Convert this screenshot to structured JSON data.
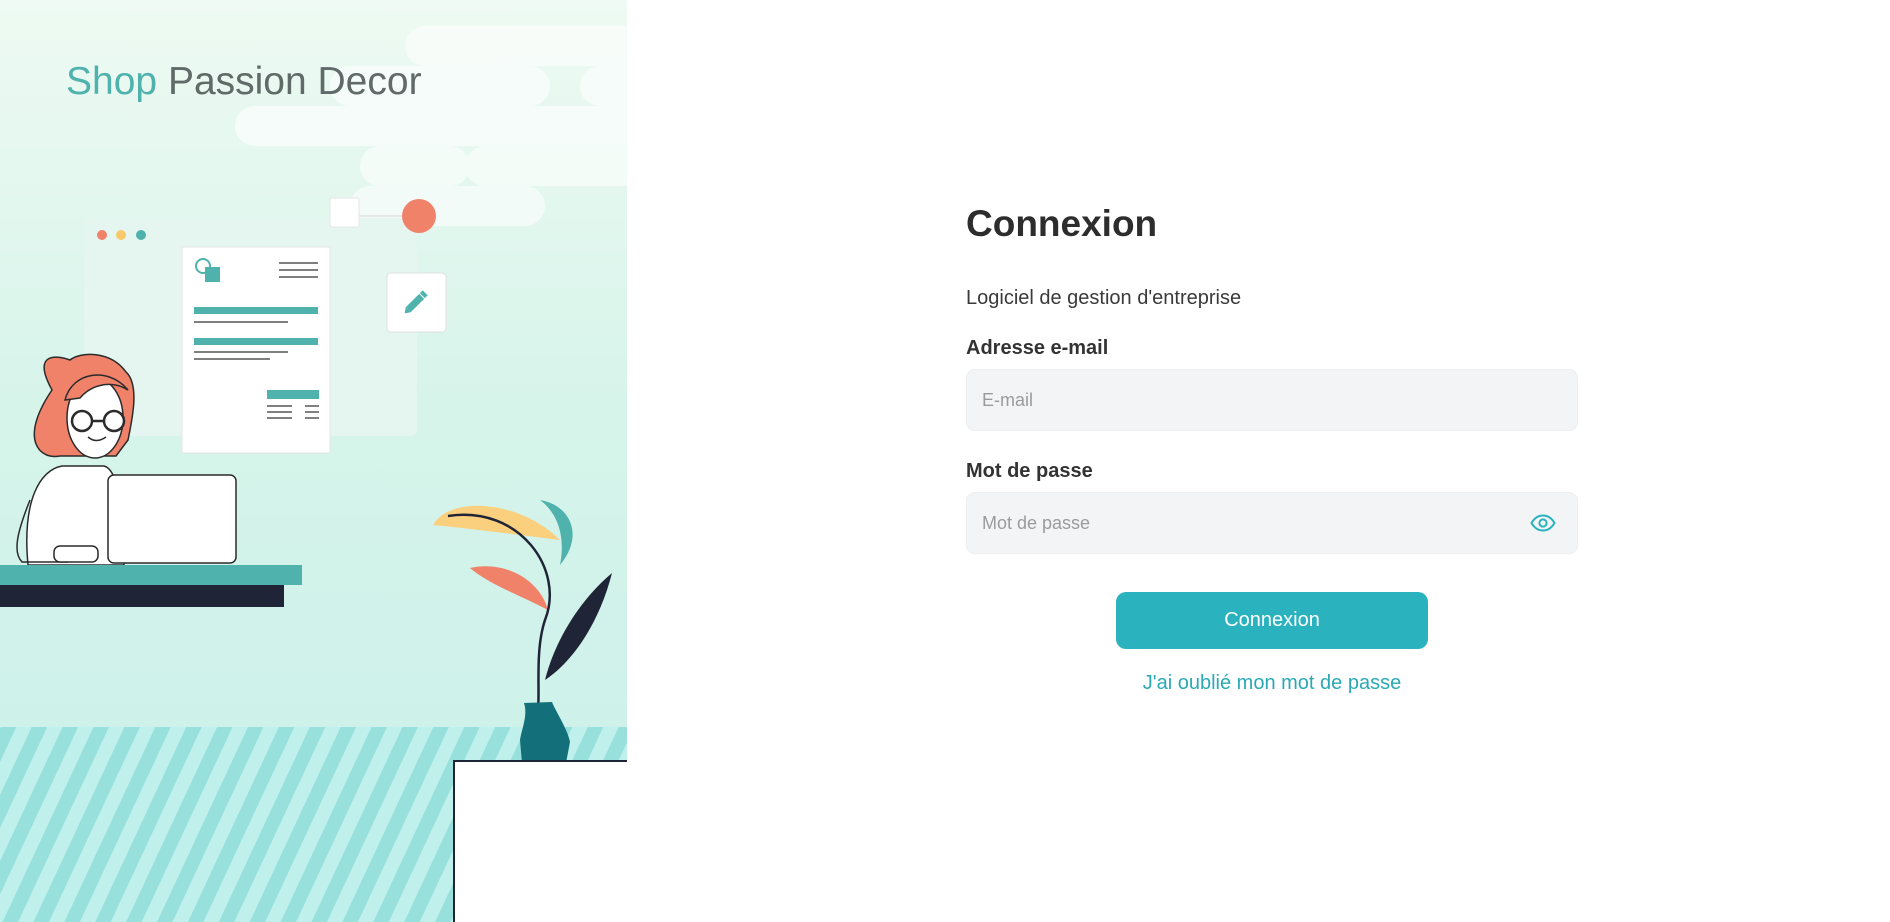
{
  "brand": {
    "part1": "Shop",
    "part2": "Passion Decor"
  },
  "login": {
    "title": "Connexion",
    "subtitle": "Logiciel de gestion d'entreprise",
    "email_label": "Adresse e-mail",
    "email_placeholder": "E-mail",
    "email_value": "",
    "password_label": "Mot de passe",
    "password_placeholder": "Mot de passe",
    "password_value": "",
    "password_toggle_icon": "eye-icon",
    "submit_label": "Connexion",
    "forgot_label": "J'ai oublié mon mot de passe"
  },
  "colors": {
    "accent": "#2ab3be",
    "brand_accent": "#4fb2ad",
    "brand_text": "#5f6a69",
    "heading": "#2d2d2d",
    "field_bg": "#f3f4f6"
  }
}
